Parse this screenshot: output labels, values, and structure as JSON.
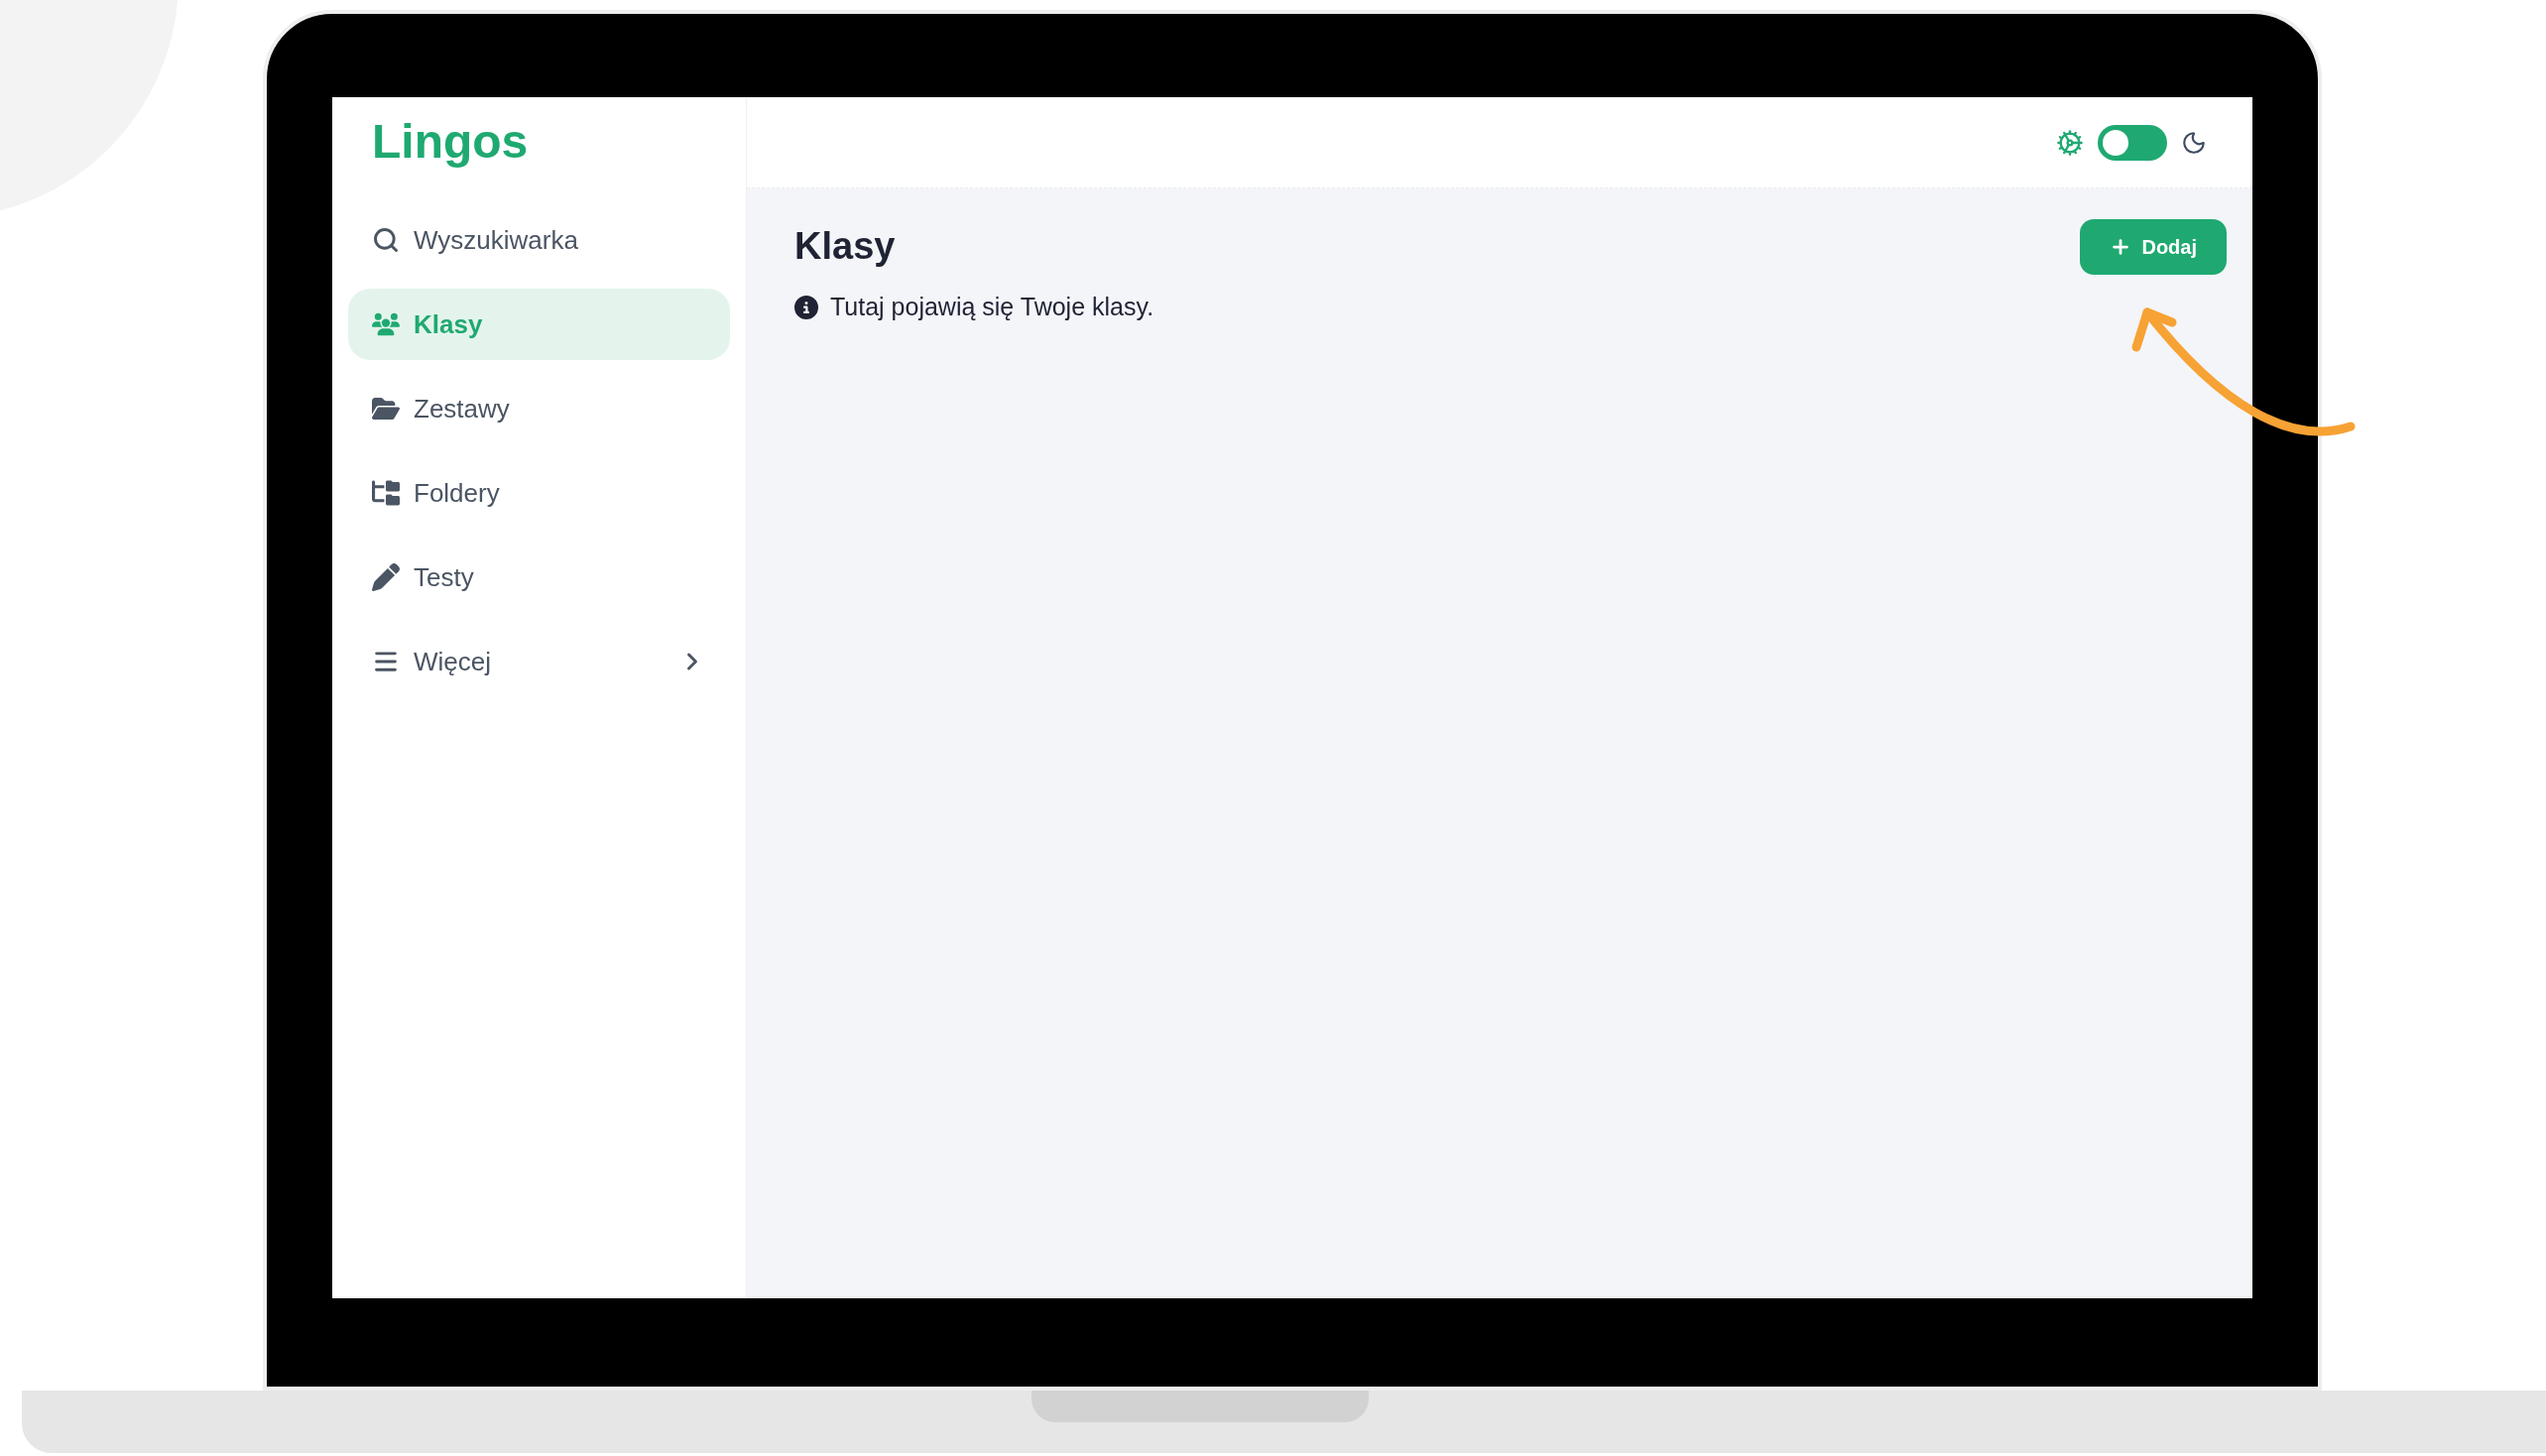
{
  "app": {
    "logo": "Lingos"
  },
  "sidebar": {
    "items": [
      {
        "label": "Wyszukiwarka",
        "kind": "link",
        "selected": false
      },
      {
        "label": "Klasy",
        "kind": "link",
        "selected": true
      },
      {
        "label": "Zestawy",
        "kind": "link",
        "selected": false
      },
      {
        "label": "Foldery",
        "kind": "link",
        "selected": false
      },
      {
        "label": "Testy",
        "kind": "link",
        "selected": false
      },
      {
        "label": "Więcej",
        "kind": "submenu",
        "selected": false
      }
    ]
  },
  "header": {
    "dark_mode": false
  },
  "page": {
    "title": "Klasy",
    "add_button": "Dodaj",
    "info": "Tutaj pojawią się Twoje klasy."
  }
}
